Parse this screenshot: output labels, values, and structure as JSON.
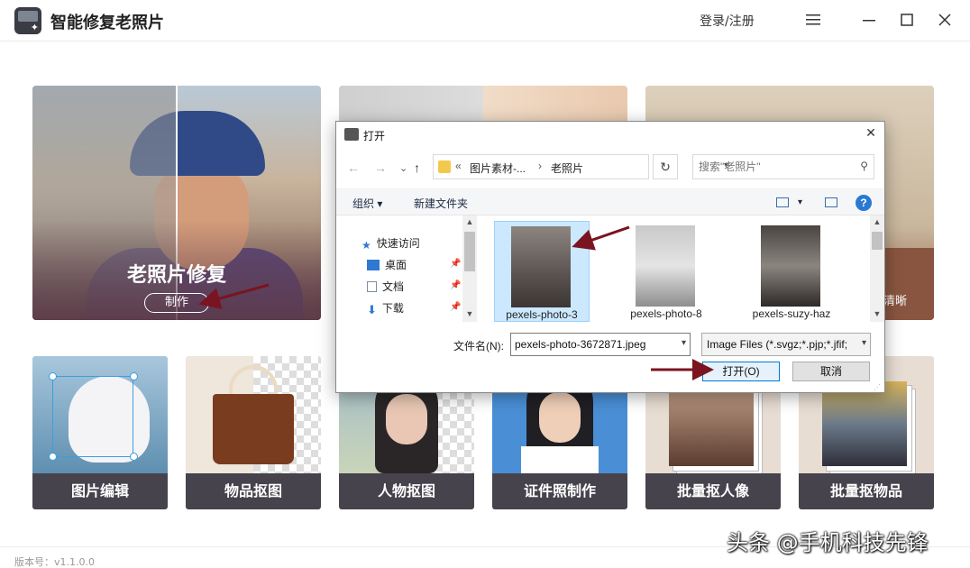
{
  "app": {
    "title": "智能修复老照片",
    "login_label": "登录/注册"
  },
  "cards": {
    "old_photo": {
      "title": "老照片修复",
      "button": "制作"
    },
    "third_partial_text": "清晰"
  },
  "tools": [
    {
      "label": "图片编辑"
    },
    {
      "label": "物品抠图"
    },
    {
      "label": "人物抠图"
    },
    {
      "label": "证件照制作"
    },
    {
      "label": "批量抠人像"
    },
    {
      "label": "批量抠物品"
    }
  ],
  "footer": {
    "version": "版本号：v1.1.0.0",
    "watermark": "头条 @手机科技先锋"
  },
  "dialog": {
    "title": "打开",
    "path": [
      "«",
      "图片素材-...",
      "老照片"
    ],
    "search_placeholder": "搜索\"老照片\"",
    "toolbar": {
      "organize": "组织 ▾",
      "new_folder": "新建文件夹"
    },
    "nav": [
      {
        "label": "快速访问",
        "icon": "star-icon"
      },
      {
        "label": "桌面",
        "icon": "desktop-icon"
      },
      {
        "label": "文档",
        "icon": "document-icon"
      },
      {
        "label": "下载",
        "icon": "download-icon"
      }
    ],
    "files": [
      {
        "name": "pexels-photo-3",
        "selected": true
      },
      {
        "name": "pexels-photo-8",
        "selected": false
      },
      {
        "name": "pexels-suzy-haz",
        "selected": false
      }
    ],
    "filename_label": "文件名(N):",
    "filename_value": "pexels-photo-3672871.jpeg",
    "filetype_value": "Image Files (*.svgz;*.pjp;*.jfif;",
    "open_label": "打开(O)",
    "cancel_label": "取消"
  },
  "colors": {
    "tool_label_bg": "#46434c",
    "annotation_arrow": "#7a1420",
    "accent_blue": "#0078d7"
  }
}
